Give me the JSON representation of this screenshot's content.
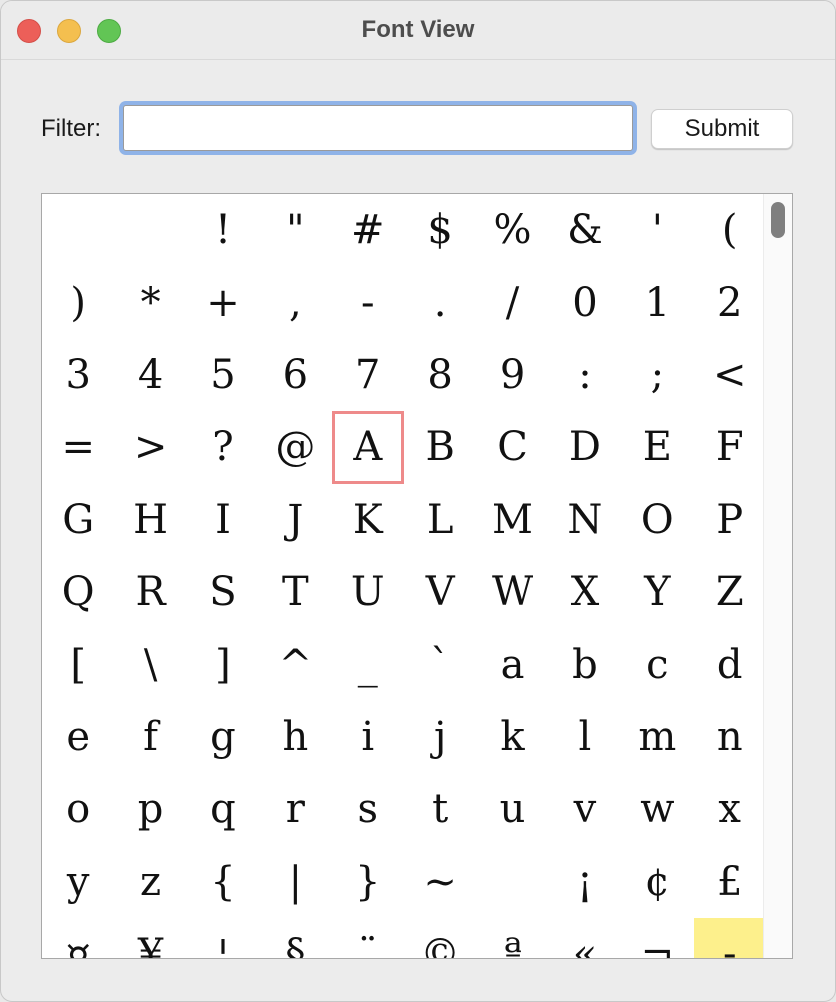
{
  "window": {
    "title": "Font View"
  },
  "filter": {
    "label": "Filter:",
    "value": "",
    "placeholder": ""
  },
  "submit": {
    "label": "Submit"
  },
  "glyph_grid": {
    "columns": 10,
    "selected_index": 34,
    "highlighted_index": 109,
    "glyphs": [
      " ",
      " ",
      "!",
      "\"",
      "#",
      "$",
      "%",
      "&",
      "'",
      "(",
      ")",
      "*",
      "+",
      ",",
      "-",
      ".",
      "/",
      "0",
      "1",
      "2",
      "3",
      "4",
      "5",
      "6",
      "7",
      "8",
      "9",
      ":",
      ";",
      "<",
      "=",
      ">",
      "?",
      "@",
      "A",
      "B",
      "C",
      "D",
      "E",
      "F",
      "G",
      "H",
      "I",
      "J",
      "K",
      "L",
      "M",
      "N",
      "O",
      "P",
      "Q",
      "R",
      "S",
      "T",
      "U",
      "V",
      "W",
      "X",
      "Y",
      "Z",
      "[",
      "\\",
      "]",
      "^",
      "_",
      "`",
      "a",
      "b",
      "c",
      "d",
      "e",
      "f",
      "g",
      "h",
      "i",
      "j",
      "k",
      "l",
      "m",
      "n",
      "o",
      "p",
      "q",
      "r",
      "s",
      "t",
      "u",
      "v",
      "w",
      "x",
      "y",
      "z",
      "{",
      "|",
      "}",
      "~",
      " ",
      "¡",
      "¢",
      "£",
      "¤",
      "¥",
      "¦",
      "§",
      "¨",
      "©",
      "ª",
      "«",
      "¬",
      "-"
    ]
  },
  "colors": {
    "selection_outline": "#ee8a8a",
    "highlight_fill": "#fdf08c",
    "focus_ring": "#8fb3e8",
    "traffic_close": "#ec5f59",
    "traffic_minimize": "#f4bf4f",
    "traffic_zoom": "#62c555"
  },
  "icons": {
    "close": "close-window-icon",
    "minimize": "minimize-window-icon",
    "zoom": "zoom-window-icon"
  }
}
